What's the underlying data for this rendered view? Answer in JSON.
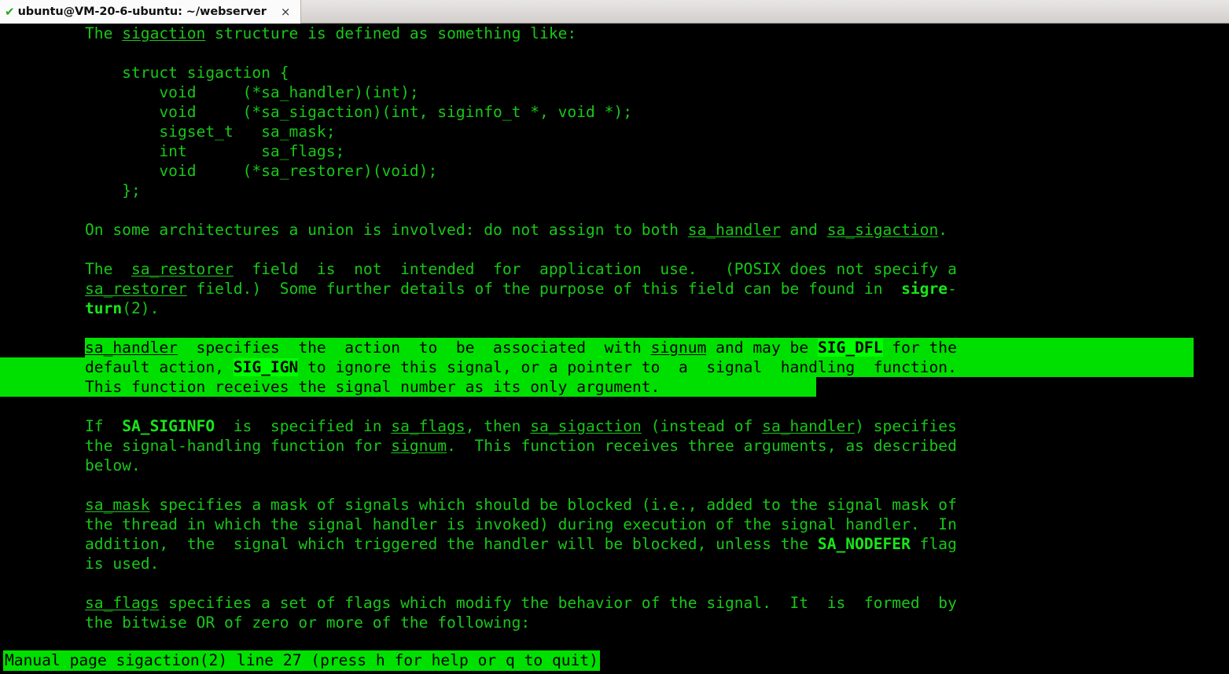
{
  "window": {
    "tab": {
      "check_icon": "✔",
      "title": "ubuntu@VM-20-6-ubuntu: ~/webserver",
      "close_icon": "×"
    }
  },
  "colors": {
    "terminal_bg": "#000000",
    "terminal_fg": "#18c718",
    "terminal_bold_fg": "#19e619",
    "selection_bg": "#00e000",
    "selection_fg": "#000000",
    "titlebar_bg": "#d6d2d0",
    "tab_bg": "#fbfbfb"
  },
  "terminal": {
    "program": "man",
    "lines": [
      {
        "id": "l01",
        "indent": 108,
        "segments": [
          {
            "t": "The "
          },
          {
            "t": "sigaction",
            "s": "u"
          },
          {
            "t": " structure is defined as something like:"
          }
        ]
      },
      {
        "id": "l02",
        "indent": 108,
        "segments": [
          {
            "t": ""
          }
        ]
      },
      {
        "id": "l03",
        "indent": 108,
        "segments": [
          {
            "t": "    struct sigaction {"
          }
        ]
      },
      {
        "id": "l04",
        "indent": 108,
        "segments": [
          {
            "t": "        void     (*sa_handler)(int);"
          }
        ]
      },
      {
        "id": "l05",
        "indent": 108,
        "segments": [
          {
            "t": "        void     (*sa_sigaction)(int, siginfo_t *, void *);"
          }
        ]
      },
      {
        "id": "l06",
        "indent": 108,
        "segments": [
          {
            "t": "        sigset_t   sa_mask;"
          }
        ]
      },
      {
        "id": "l07",
        "indent": 108,
        "segments": [
          {
            "t": "        int        sa_flags;"
          }
        ]
      },
      {
        "id": "l08",
        "indent": 108,
        "segments": [
          {
            "t": "        void     (*sa_restorer)(void);"
          }
        ]
      },
      {
        "id": "l09",
        "indent": 108,
        "segments": [
          {
            "t": "    };"
          }
        ]
      },
      {
        "id": "l10",
        "indent": 108,
        "segments": [
          {
            "t": ""
          }
        ]
      },
      {
        "id": "l11",
        "indent": 108,
        "segments": [
          {
            "t": "On some architectures a union is involved: do not assign to both "
          },
          {
            "t": "sa_handler",
            "s": "u"
          },
          {
            "t": " and "
          },
          {
            "t": "sa_sigaction",
            "s": "u"
          },
          {
            "t": "."
          }
        ]
      },
      {
        "id": "l12",
        "indent": 108,
        "segments": [
          {
            "t": ""
          }
        ]
      },
      {
        "id": "l13",
        "indent": 108,
        "segments": [
          {
            "t": "The  "
          },
          {
            "t": "sa_restorer",
            "s": "u"
          },
          {
            "t": "  field  is  not  intended  for  application  use.   (POSIX does not specify a"
          }
        ]
      },
      {
        "id": "l14",
        "indent": 108,
        "segments": [
          {
            "t": "sa_restorer",
            "s": "u"
          },
          {
            "t": " field.)  Some further details of the purpose of this field can be found in  "
          },
          {
            "t": "sigre",
            "s": "b"
          },
          {
            "t": "-"
          }
        ]
      },
      {
        "id": "l15",
        "indent": 108,
        "segments": [
          {
            "t": "turn",
            "s": "b"
          },
          {
            "t": "(2)."
          }
        ]
      },
      {
        "id": "l16",
        "indent": 108,
        "segments": [
          {
            "t": ""
          }
        ]
      },
      {
        "id": "l17",
        "indent": 108,
        "selection": {
          "from": 108,
          "to": 1518
        },
        "segments": [
          {
            "t": "sa_handler",
            "s": "u sel"
          },
          {
            "t": "  specifies  the  action  to  be  associated  with ",
            "s": "sel"
          },
          {
            "t": "signum",
            "s": "u sel"
          },
          {
            "t": " and may be ",
            "s": "sel"
          },
          {
            "t": "SIG_DFL",
            "s": "b sel"
          },
          {
            "t": " for the",
            "s": "sel"
          }
        ]
      },
      {
        "id": "l18",
        "indent": 108,
        "selection": {
          "from": 0,
          "to": 1518
        },
        "segments": [
          {
            "t": "default action, ",
            "s": "sel"
          },
          {
            "t": "SIG_IGN",
            "s": "b sel"
          },
          {
            "t": " to ignore this signal, or a pointer to  a  signal  handling  function.",
            "s": "sel"
          }
        ]
      },
      {
        "id": "l19",
        "indent": 108,
        "selection": {
          "from": 0,
          "to": 1038
        },
        "segments": [
          {
            "t": "This function receives the signal number as its only argument.",
            "s": "sel"
          }
        ]
      },
      {
        "id": "l20",
        "indent": 108,
        "segments": [
          {
            "t": ""
          }
        ]
      },
      {
        "id": "l21",
        "indent": 108,
        "segments": [
          {
            "t": "If  "
          },
          {
            "t": "SA_SIGINFO",
            "s": "b"
          },
          {
            "t": "  is  specified in "
          },
          {
            "t": "sa_flags",
            "s": "u"
          },
          {
            "t": ", then "
          },
          {
            "t": "sa_sigaction",
            "s": "u"
          },
          {
            "t": " (instead of "
          },
          {
            "t": "sa_handler",
            "s": "u"
          },
          {
            "t": ") specifies"
          }
        ]
      },
      {
        "id": "l22",
        "indent": 108,
        "segments": [
          {
            "t": "the signal-handling function for "
          },
          {
            "t": "signum",
            "s": "u"
          },
          {
            "t": ".  This function receives three arguments, as described"
          }
        ]
      },
      {
        "id": "l23",
        "indent": 108,
        "segments": [
          {
            "t": "below."
          }
        ]
      },
      {
        "id": "l24",
        "indent": 108,
        "segments": [
          {
            "t": ""
          }
        ]
      },
      {
        "id": "l25",
        "indent": 108,
        "segments": [
          {
            "t": "sa_mask",
            "s": "u"
          },
          {
            "t": " specifies a mask of signals which should be blocked (i.e., added to the signal mask of"
          }
        ]
      },
      {
        "id": "l26",
        "indent": 108,
        "segments": [
          {
            "t": "the thread in which the signal handler is invoked) during execution of the signal handler.  In"
          }
        ]
      },
      {
        "id": "l27",
        "indent": 108,
        "segments": [
          {
            "t": "addition,  the  signal which triggered the handler will be blocked, unless the "
          },
          {
            "t": "SA_NODEFER",
            "s": "b"
          },
          {
            "t": " flag"
          }
        ]
      },
      {
        "id": "l28",
        "indent": 108,
        "segments": [
          {
            "t": "is used."
          }
        ]
      },
      {
        "id": "l29",
        "indent": 108,
        "segments": [
          {
            "t": ""
          }
        ]
      },
      {
        "id": "l30",
        "indent": 108,
        "segments": [
          {
            "t": "sa_flags",
            "s": "u"
          },
          {
            "t": " specifies a set of flags which modify the behavior of the signal.  It  is  formed  by"
          }
        ]
      },
      {
        "id": "l31",
        "indent": 108,
        "segments": [
          {
            "t": "the bitwise OR of zero or more of the following:"
          }
        ]
      }
    ],
    "status_line": "Manual page sigaction(2) line 27 (press h for help or q to quit)"
  }
}
